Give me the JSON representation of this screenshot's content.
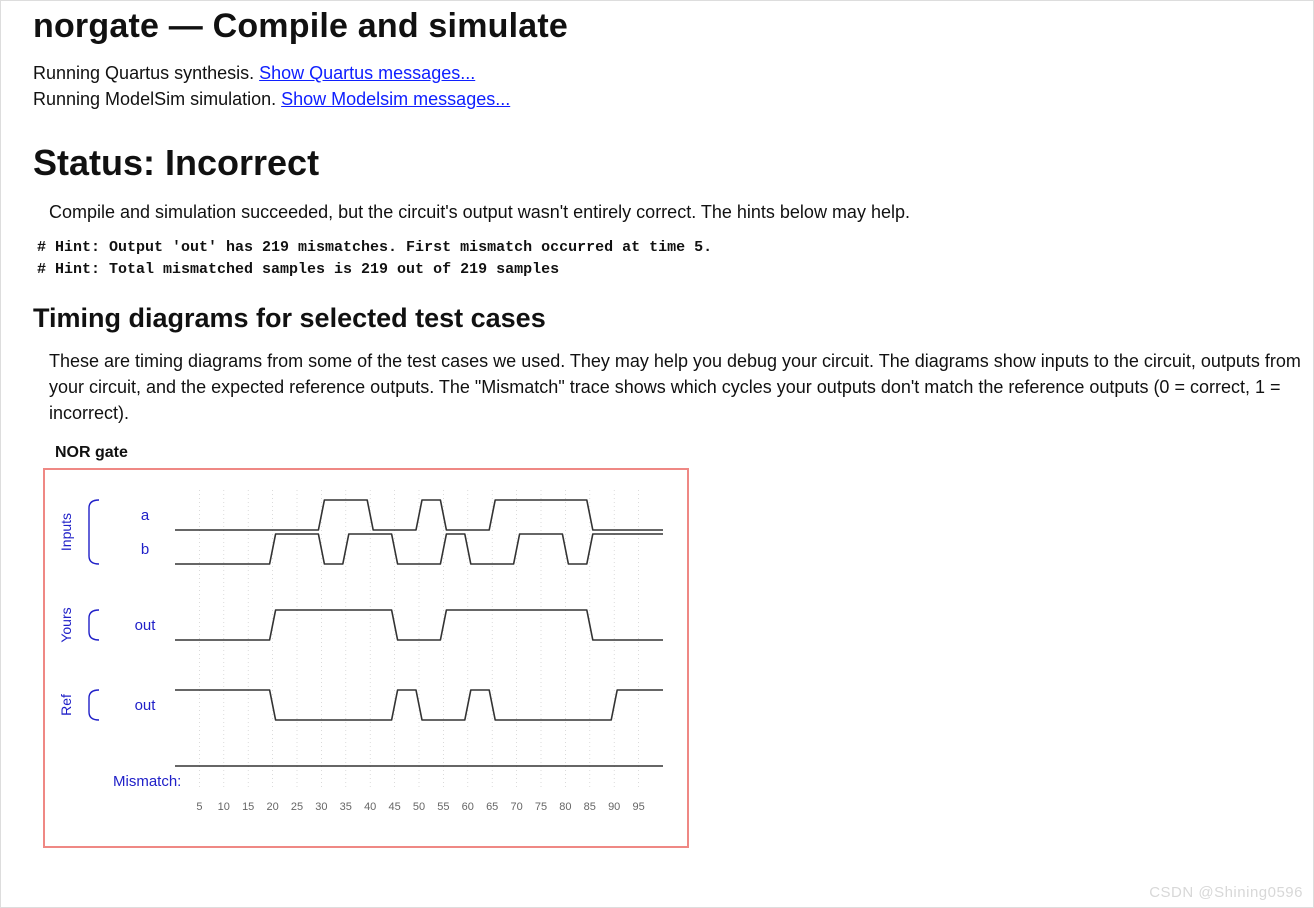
{
  "title": "norgate — Compile and simulate",
  "run": {
    "line1_text": "Running Quartus synthesis. ",
    "line1_link": "Show Quartus messages...",
    "line2_text": "Running ModelSim simulation. ",
    "line2_link": "Show Modelsim messages..."
  },
  "status_heading": "Status: Incorrect",
  "status_desc": "Compile and simulation succeeded, but the circuit's output wasn't entirely correct. The hints below may help.",
  "hints": "# Hint: Output 'out' has 219 mismatches. First mismatch occurred at time 5.\n# Hint: Total mismatched samples is 219 out of 219 samples",
  "timing_heading": "Timing diagrams for selected test cases",
  "timing_intro": "These are timing diagrams from some of the test cases we used. They may help you debug your circuit. The diagrams show inputs to the circuit, outputs from your circuit, and the expected reference outputs. The \"Mismatch\" trace shows which cycles your outputs don't match the reference outputs (0 = correct, 1 = incorrect).",
  "diagram_label": "NOR gate",
  "watermark": "CSDN @Shining0596",
  "chart_data": {
    "type": "timing-diagram",
    "time_axis": {
      "start": 0,
      "end": 100,
      "step": 5,
      "ticks": [
        5,
        10,
        15,
        20,
        25,
        30,
        35,
        40,
        45,
        50,
        55,
        60,
        65,
        70,
        75,
        80,
        85,
        90,
        95
      ],
      "unit": "ns"
    },
    "groups": [
      {
        "name": "Inputs",
        "signals": [
          "a",
          "b"
        ]
      },
      {
        "name": "Yours",
        "signals": [
          "out"
        ]
      },
      {
        "name": "Ref",
        "signals": [
          "out"
        ]
      },
      {
        "name": "Mismatch",
        "signals": [
          "Mismatch:"
        ]
      }
    ],
    "signals": {
      "a": {
        "initial": 0,
        "transitions": [
          [
            30,
            1
          ],
          [
            40,
            0
          ],
          [
            50,
            1
          ],
          [
            55,
            0
          ],
          [
            65,
            1
          ],
          [
            85,
            0
          ]
        ]
      },
      "b": {
        "initial": 0,
        "transitions": [
          [
            20,
            1
          ],
          [
            30,
            0
          ],
          [
            35,
            1
          ],
          [
            45,
            0
          ],
          [
            55,
            1
          ],
          [
            60,
            0
          ],
          [
            70,
            1
          ],
          [
            80,
            0
          ],
          [
            85,
            1
          ]
        ]
      },
      "yours_out": {
        "initial": 0,
        "transitions": [
          [
            20,
            1
          ],
          [
            45,
            0
          ],
          [
            55,
            1
          ],
          [
            85,
            0
          ]
        ]
      },
      "ref_out": {
        "initial": 1,
        "transitions": [
          [
            20,
            0
          ],
          [
            45,
            1
          ],
          [
            50,
            0
          ],
          [
            60,
            1
          ],
          [
            65,
            0
          ],
          [
            90,
            1
          ]
        ]
      },
      "mismatch": {
        "initial": 1,
        "transitions": []
      }
    },
    "colors": {
      "border": "#ef8884",
      "label": "#2020c8",
      "trace": "#333333",
      "grid": "#cccccc"
    }
  }
}
